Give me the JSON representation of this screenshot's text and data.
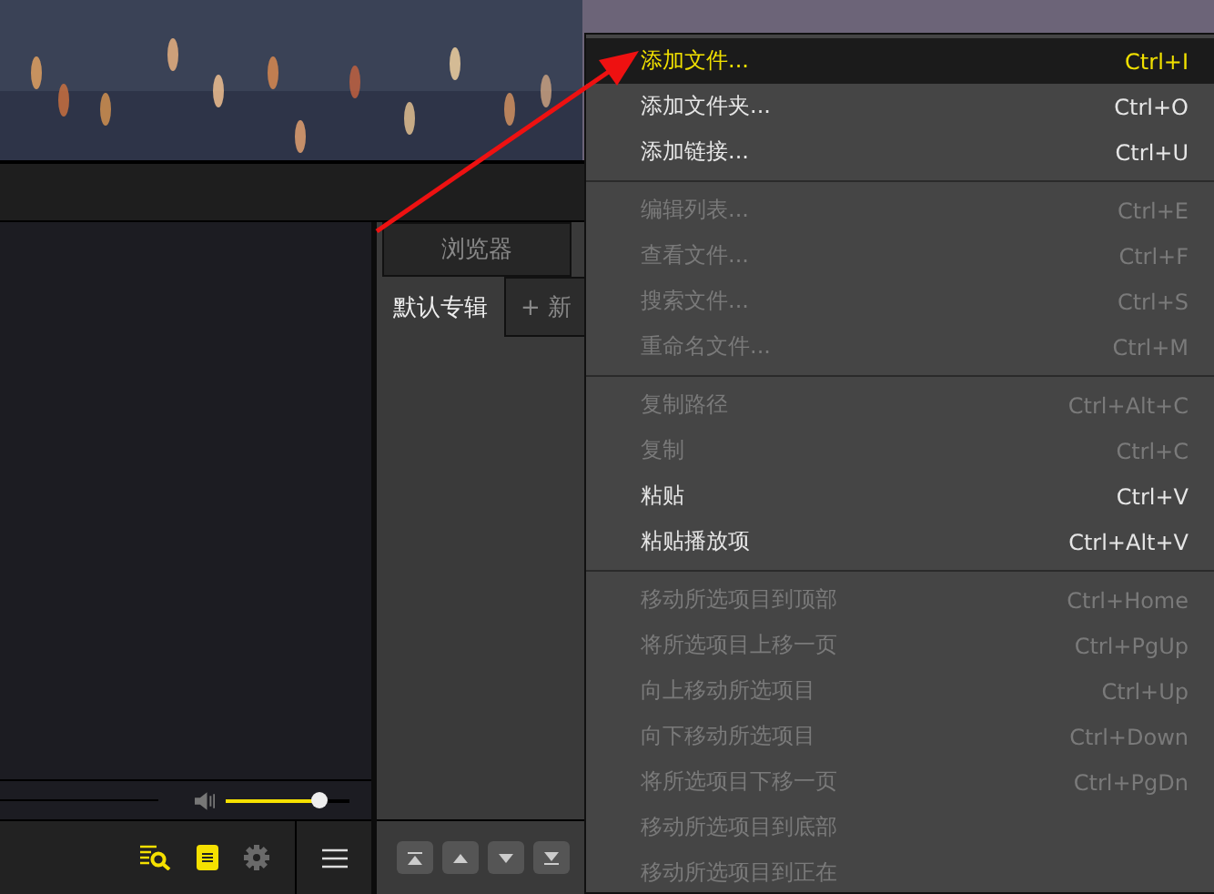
{
  "browser": {
    "title": "浏览器"
  },
  "playlist_tabs": [
    {
      "label": "默认专辑",
      "selected": true
    },
    {
      "label": "+ 新",
      "selected": false
    }
  ],
  "volume": {
    "level": 0.77
  },
  "context_menu": {
    "items": [
      {
        "kind": "item",
        "label": "添加文件...",
        "shortcut": "Ctrl+I",
        "disabled": false,
        "selected": true
      },
      {
        "kind": "item",
        "label": "添加文件夹...",
        "shortcut": "Ctrl+O",
        "disabled": false,
        "selected": false
      },
      {
        "kind": "item",
        "label": "添加链接...",
        "shortcut": "Ctrl+U",
        "disabled": false,
        "selected": false
      },
      {
        "kind": "separator"
      },
      {
        "kind": "item",
        "label": "编辑列表...",
        "shortcut": "Ctrl+E",
        "disabled": true,
        "selected": false
      },
      {
        "kind": "item",
        "label": "查看文件...",
        "shortcut": "Ctrl+F",
        "disabled": true,
        "selected": false
      },
      {
        "kind": "item",
        "label": "搜索文件...",
        "shortcut": "Ctrl+S",
        "disabled": true,
        "selected": false
      },
      {
        "kind": "item",
        "label": "重命名文件...",
        "shortcut": "Ctrl+M",
        "disabled": true,
        "selected": false
      },
      {
        "kind": "separator"
      },
      {
        "kind": "item",
        "label": "复制路径",
        "shortcut": "Ctrl+Alt+C",
        "disabled": true,
        "selected": false
      },
      {
        "kind": "item",
        "label": "复制",
        "shortcut": "Ctrl+C",
        "disabled": true,
        "selected": false
      },
      {
        "kind": "item",
        "label": "粘贴",
        "shortcut": "Ctrl+V",
        "disabled": false,
        "selected": false
      },
      {
        "kind": "item",
        "label": "粘贴播放项",
        "shortcut": "Ctrl+Alt+V",
        "disabled": false,
        "selected": false
      },
      {
        "kind": "separator"
      },
      {
        "kind": "item",
        "label": "移动所选项目到顶部",
        "shortcut": "Ctrl+Home",
        "disabled": true,
        "selected": false
      },
      {
        "kind": "item",
        "label": "将所选项目上移一页",
        "shortcut": "Ctrl+PgUp",
        "disabled": true,
        "selected": false
      },
      {
        "kind": "item",
        "label": "向上移动所选项目",
        "shortcut": "Ctrl+Up",
        "disabled": true,
        "selected": false
      },
      {
        "kind": "item",
        "label": "向下移动所选项目",
        "shortcut": "Ctrl+Down",
        "disabled": true,
        "selected": false
      },
      {
        "kind": "item",
        "label": "将所选项目下移一页",
        "shortcut": "Ctrl+PgDn",
        "disabled": true,
        "selected": false
      },
      {
        "kind": "item",
        "label": "移动所选项目到底部",
        "disabled": true,
        "selected": false
      },
      {
        "kind": "item",
        "label": "移动所选项目到正在",
        "disabled": true,
        "selected": false
      }
    ]
  }
}
